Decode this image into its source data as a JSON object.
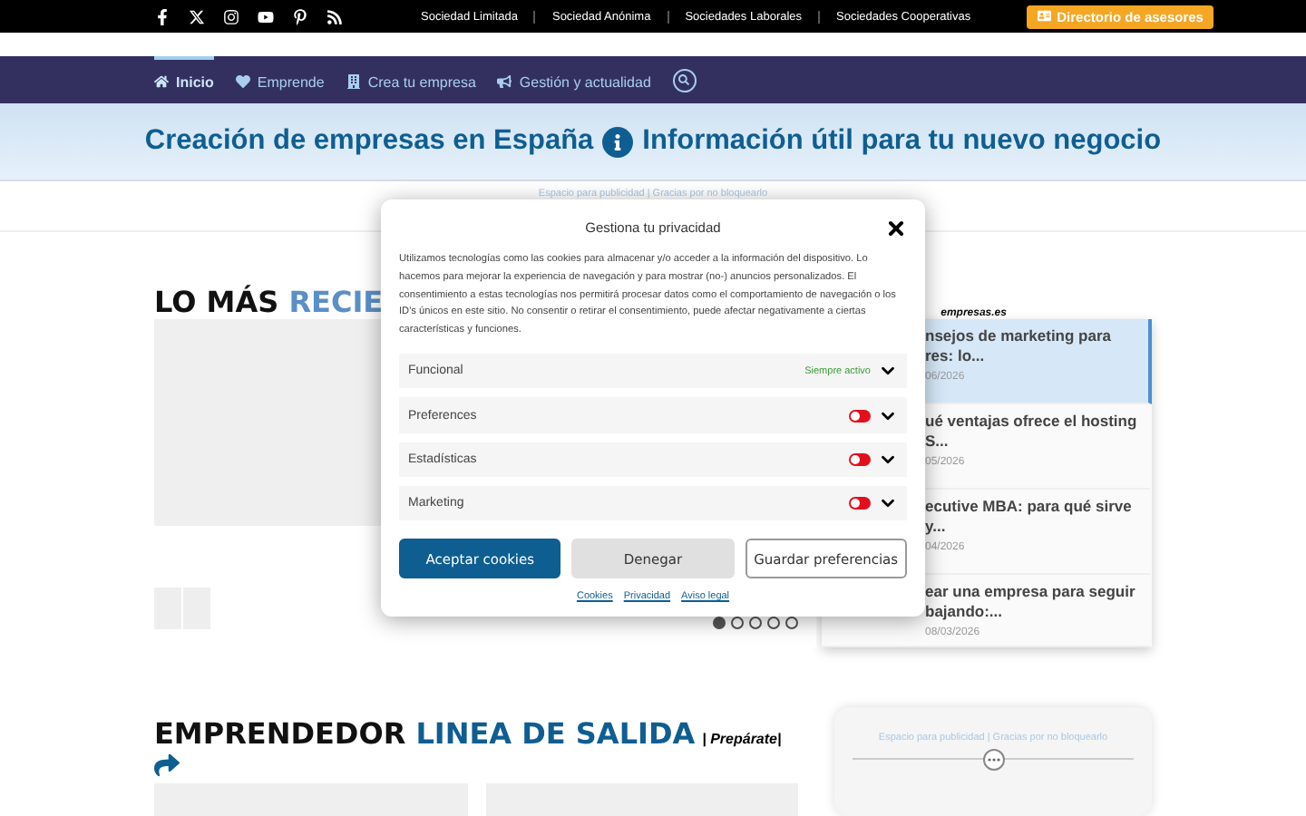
{
  "topbar": {
    "links": [
      "Sociedad Limitada",
      "Sociedad Anónima",
      "Sociedades Laborales",
      "Sociedades Cooperativas"
    ],
    "cta": "Directorio de asesores"
  },
  "nav": [
    {
      "label": "Inicio",
      "selected": true
    },
    {
      "label": "Emprende",
      "selected": false
    },
    {
      "label": "Crea tu empresa",
      "selected": false
    },
    {
      "label": "Gestión y actualidad",
      "selected": false
    }
  ],
  "hero": {
    "left": "Creación de empresas en España",
    "right": "Información útil para tu nuevo negocio"
  },
  "ad_note": "Espacio para publicidad | Gracias por no bloquearlo",
  "latest": {
    "title_dark": "LO MÁS ",
    "title_light": "RECIE",
    "source": "empresas.es",
    "items": [
      {
        "title": "nsejos de marketing para res: lo...",
        "date": "06/2026",
        "selected": true
      },
      {
        "title": "ué ventajas ofrece el hosting S...",
        "date": "05/2026",
        "selected": false
      },
      {
        "title": "ecutive MBA: para qué sirve y...",
        "date": "04/2026",
        "selected": false
      },
      {
        "title": "ear una empresa para seguir bajando:...",
        "date": "08/03/2026",
        "selected": false
      }
    ],
    "dots": [
      {
        "selected": true
      },
      {
        "selected": false
      },
      {
        "selected": false
      },
      {
        "selected": false
      },
      {
        "selected": false
      }
    ]
  },
  "section2": {
    "title_dark": "EMPRENDEDOR ",
    "title_light": "LINEA DE SALIDA",
    "tag": "| Prepárate|",
    "ad_note": "Espacio para publicidad | Gracias por no bloquearlo"
  },
  "modal": {
    "title": "Gestiona tu privacidad",
    "text": "Utilizamos tecnologías como las cookies para almacenar y/o acceder a la información del dispositivo. Lo hacemos para mejorar la experiencia de navegación y para mostrar (no-) anuncios personalizados. El consentimiento a estas tecnologías nos permitirá procesar datos como el comportamiento de navegación o los ID's únicos en este sitio. No consentir o retirar el consentimiento, puede afectar negativamente a ciertas características y funciones.",
    "categories": [
      {
        "label": "Funcional",
        "kind": "always",
        "status": "Siempre activo"
      },
      {
        "label": "Preferences",
        "kind": "toggle",
        "on": false
      },
      {
        "label": "Estadísticas",
        "kind": "toggle",
        "on": false
      },
      {
        "label": "Marketing",
        "kind": "toggle",
        "on": false
      }
    ],
    "buttons": [
      {
        "label": "Aceptar cookies",
        "kind": "primary"
      },
      {
        "label": "Denegar",
        "kind": "secondary"
      },
      {
        "label": "Guardar preferencias",
        "kind": "outline"
      }
    ],
    "links": [
      "Cookies",
      "Privacidad",
      "Aviso legal"
    ]
  }
}
